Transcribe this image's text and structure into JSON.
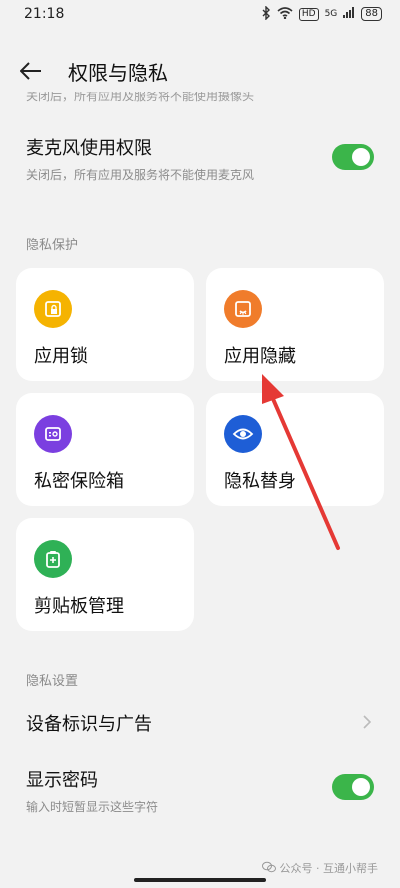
{
  "status_bar": {
    "time": "21:18",
    "hd": "HD",
    "signal": "5G",
    "battery": "88"
  },
  "header": {
    "title": "权限与隐私"
  },
  "camera_row": {
    "subtitle_cut": "关闭后，所有应用及服务将不能使用摄像头"
  },
  "microphone_row": {
    "title": "麦克风使用权限",
    "subtitle": "关闭后，所有应用及服务将不能使用麦克风",
    "enabled": true
  },
  "privacy_protection": {
    "label": "隐私保护",
    "cards": [
      {
        "label": "应用锁",
        "icon": "app-lock-icon",
        "color": "#f5b301"
      },
      {
        "label": "应用隐藏",
        "icon": "app-hide-icon",
        "color": "#f07c2b"
      },
      {
        "label": "私密保险箱",
        "icon": "private-safe-icon",
        "color": "#7b3fe0"
      },
      {
        "label": "隐私替身",
        "icon": "privacy-eye-icon",
        "color": "#1e5ed6"
      },
      {
        "label": "剪贴板管理",
        "icon": "clipboard-icon",
        "color": "#2fb156"
      }
    ]
  },
  "privacy_settings": {
    "label": "隐私设置",
    "device_id_row": {
      "title": "设备标识与广告"
    },
    "show_password_row": {
      "title": "显示密码",
      "subtitle": "输入时短暂显示这些字符",
      "enabled": true
    }
  },
  "watermark": {
    "text": "公众号 · 互通小帮手"
  },
  "colors": {
    "toggle_on": "#3bb54a",
    "annotation_arrow": "#e53935",
    "background": "#f2f2f2"
  }
}
